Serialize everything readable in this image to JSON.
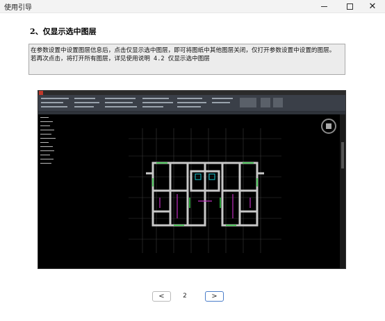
{
  "window": {
    "title": "使用引导",
    "minimize_icon": "minimize-icon",
    "maximize_icon": "maximize-icon",
    "close_icon": "close-icon"
  },
  "section": {
    "heading": "2、仅显示选中图层",
    "description_lines": [
      "在参数设置中设置图层信息后，点击仅显示选中图层，即可将图纸中其他图层关闭，仅打开参数设置中设置的图层。",
      "若再次点击，将打开所有图层，详见使用说明 4.2 仅显示选中图层"
    ]
  },
  "illustration": {
    "description": "CAD screenshot",
    "colors": {
      "wall": "#c8c8c8",
      "accent_green": "#2ecc40",
      "accent_magenta": "#c030c0",
      "accent_cyan": "#19c8d2",
      "grid": "#3a3a3a"
    }
  },
  "pager": {
    "prev_icon": "chevron-left-icon",
    "next_icon": "chevron-right-icon",
    "prev_label": "<",
    "next_label": ">",
    "current_page": "2"
  }
}
